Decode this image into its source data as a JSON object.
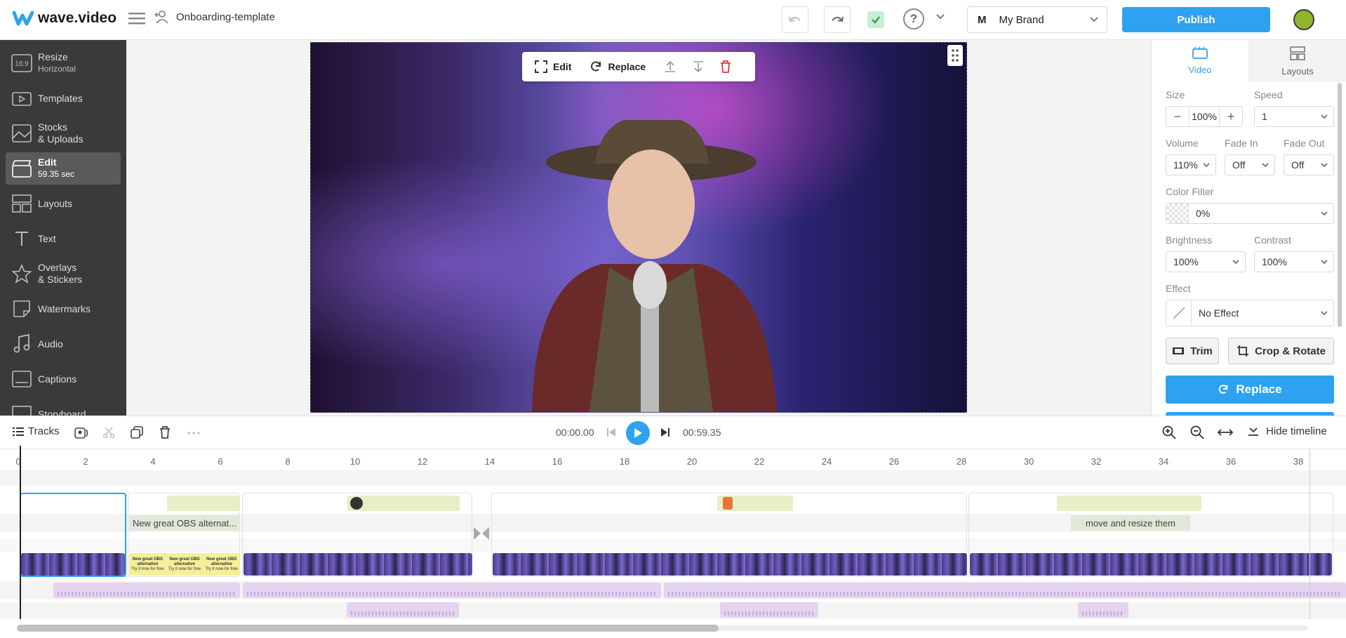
{
  "app": {
    "logo_text": "wave.video",
    "project_name": "Onboarding-template"
  },
  "header": {
    "brand_letter": "M",
    "brand_name": "My Brand",
    "publish_label": "Publish",
    "help_symbol": "?"
  },
  "sidebar": {
    "items": [
      {
        "label": "Resize",
        "sub": "Horizontal",
        "icon_text": "16:9"
      },
      {
        "label": "Templates",
        "sub": ""
      },
      {
        "label": "Stocks",
        "sub": "& Uploads"
      },
      {
        "label": "Edit",
        "sub": "59.35 sec"
      },
      {
        "label": "Layouts",
        "sub": ""
      },
      {
        "label": "Text",
        "sub": ""
      },
      {
        "label": "Overlays",
        "sub": "& Stickers"
      },
      {
        "label": "Watermarks",
        "sub": ""
      },
      {
        "label": "Audio",
        "sub": ""
      },
      {
        "label": "Captions",
        "sub": ""
      },
      {
        "label": "Storyboard",
        "sub": ""
      }
    ]
  },
  "canvas_toolbar": {
    "edit_label": "Edit",
    "replace_label": "Replace"
  },
  "right_panel": {
    "tabs": [
      {
        "label": "Video"
      },
      {
        "label": "Layouts"
      }
    ],
    "size_label": "Size",
    "size_value": "100%",
    "speed_label": "Speed",
    "speed_value": "1",
    "volume_label": "Volume",
    "volume_value": "110%",
    "fadein_label": "Fade In",
    "fadein_value": "Off",
    "fadeout_label": "Fade Out",
    "fadeout_value": "Off",
    "colorfilter_label": "Color Filter",
    "colorfilter_value": "0%",
    "brightness_label": "Brightness",
    "brightness_value": "100%",
    "contrast_label": "Contrast",
    "contrast_value": "100%",
    "effect_label": "Effect",
    "effect_value": "No Effect",
    "trim_label": "Trim",
    "crop_label": "Crop & Rotate",
    "replace_label": "Replace"
  },
  "timeline": {
    "tracks_label": "Tracks",
    "current_time": "00:00.00",
    "total_time": "00:59.35",
    "hide_label": "Hide timeline",
    "ruler": [
      "0",
      "2",
      "4",
      "6",
      "8",
      "10",
      "12",
      "14",
      "16",
      "18",
      "20",
      "22",
      "24",
      "26",
      "28",
      "30",
      "32",
      "34",
      "36",
      "38"
    ],
    "text_clips": [
      "New great  OBS alternat...",
      "move and resize them"
    ],
    "slide_text": "New great OBS alternative",
    "slide_sub": "Try it now for free"
  },
  "colors": {
    "accent": "#2ea2f0",
    "sidebar_bg": "#3a3a3a",
    "active_item": "#5a5a5a"
  }
}
